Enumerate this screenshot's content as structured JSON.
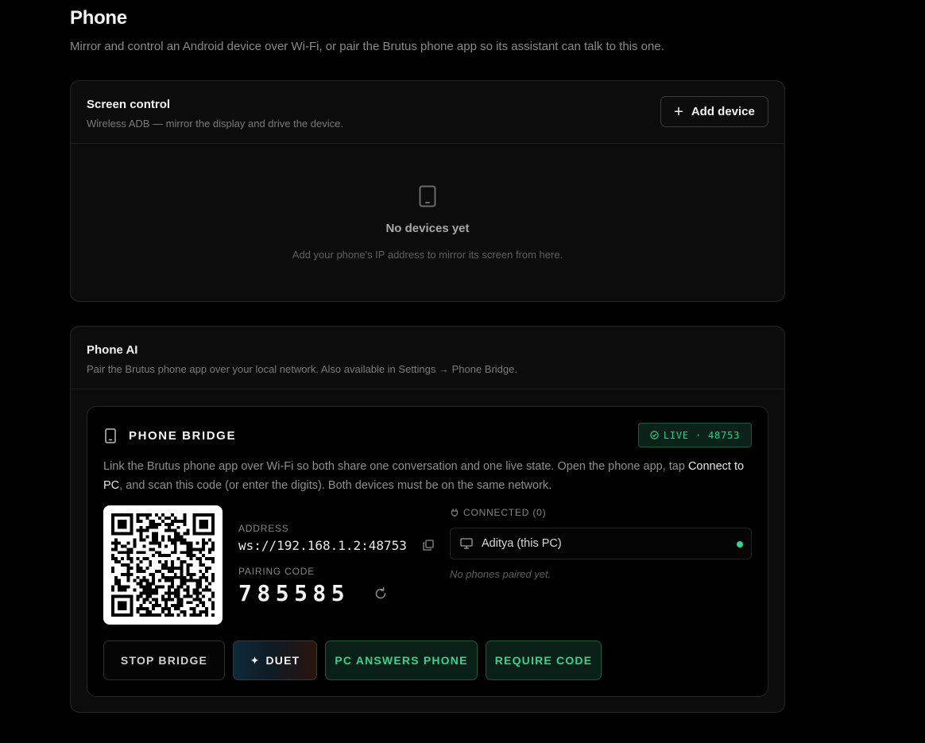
{
  "page": {
    "title": "Phone",
    "subtitle": "Mirror and control an Android device over Wi-Fi, or pair the Brutus phone app so its assistant can talk to this one."
  },
  "screen_control": {
    "title": "Screen control",
    "description": "Wireless ADB — mirror the display and drive the device.",
    "add_device_label": "Add device",
    "empty_title": "No devices yet",
    "empty_description": "Add your phone's IP address to mirror its screen from here."
  },
  "phone_ai": {
    "title": "Phone AI",
    "description": "Pair the Brutus phone app over your local network. Also available in Settings → Phone Bridge."
  },
  "bridge": {
    "title": "PHONE BRIDGE",
    "live_badge": "LIVE · 48753",
    "description_1": "Link the Brutus phone app over Wi-Fi so both share one conversation and one live state. Open the phone app, tap ",
    "description_highlight": "Connect to PC",
    "description_2": ", and scan this code (or enter the digits). Both devices must be on the same network.",
    "address_label": "ADDRESS",
    "address_value": "ws://192.168.1.2:48753",
    "pairing_label": "PAIRING CODE",
    "pairing_code": "785585",
    "connected_label": "CONNECTED (0)",
    "connected_device": "Aditya (this PC)",
    "no_phones": "No phones paired yet.",
    "buttons": {
      "stop": "STOP BRIDGE",
      "duet": "DUET",
      "duet_symbol": "✦",
      "pc_answers": "PC ANSWERS PHONE",
      "require_code": "REQUIRE CODE"
    }
  },
  "colors": {
    "background": "#000000",
    "card": "#0c0c0c",
    "accent_green": "#2fcf86"
  }
}
